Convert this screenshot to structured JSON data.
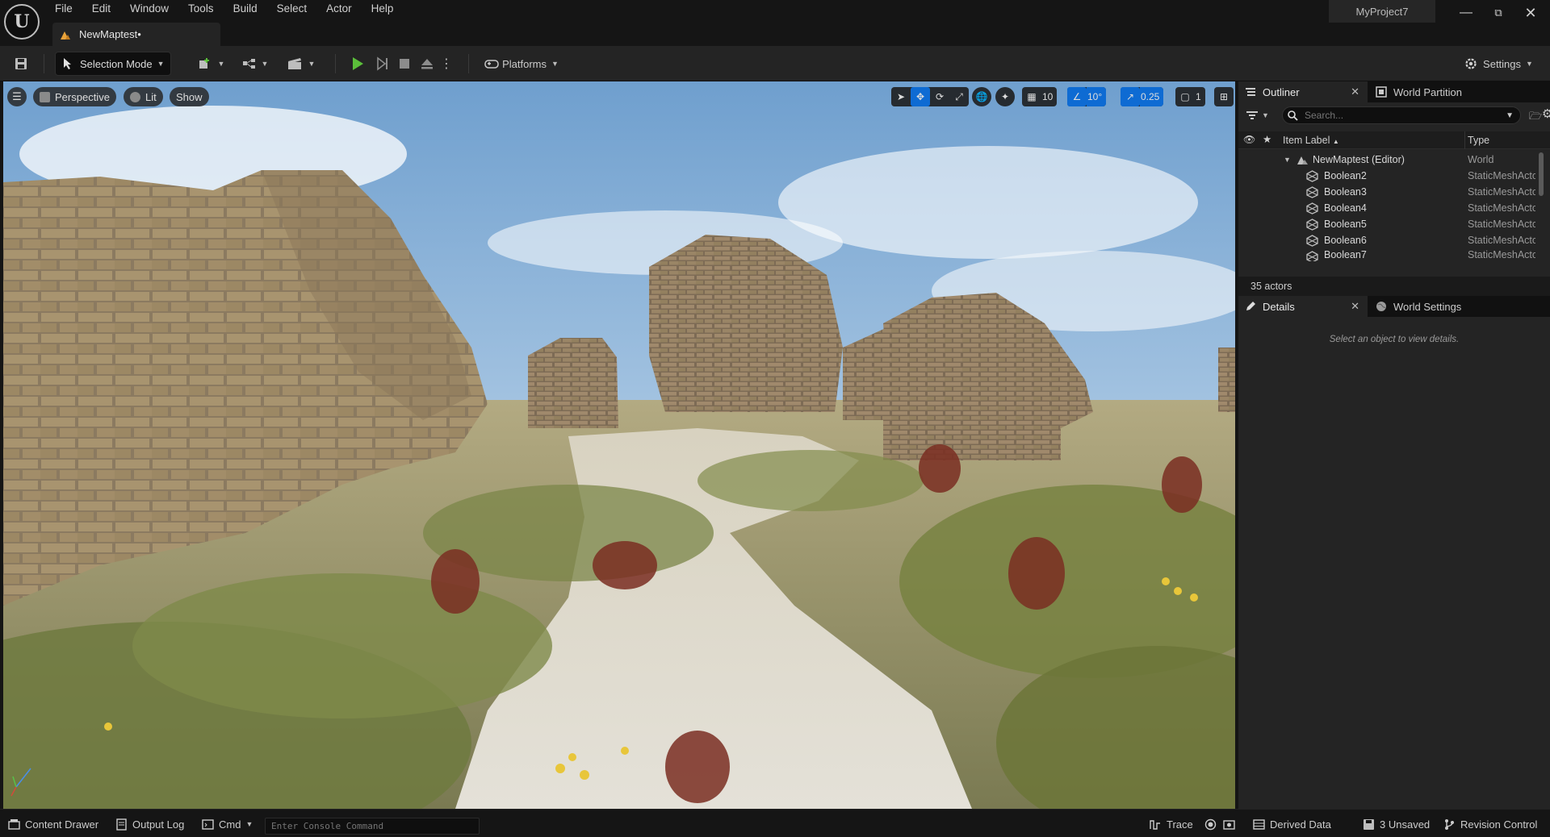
{
  "menu": [
    "File",
    "Edit",
    "Window",
    "Tools",
    "Build",
    "Select",
    "Actor",
    "Help"
  ],
  "project_name": "MyProject7",
  "document_tab": "NewMaptest•",
  "toolbar": {
    "selection_mode": "Selection Mode",
    "platforms": "Platforms",
    "settings": "Settings"
  },
  "viewport": {
    "perspective": "Perspective",
    "lit": "Lit",
    "show": "Show",
    "grid_snap": "10",
    "rotation_snap": "10°",
    "scale_snap": "0.25",
    "camera_speed": "1"
  },
  "outliner": {
    "tab_label": "Outliner",
    "world_partition_tab": "World Partition",
    "search_placeholder": "Search...",
    "col_label": "Item Label",
    "col_type": "Type",
    "world_row": {
      "label": "NewMaptest (Editor)",
      "type": "World"
    },
    "rows": [
      {
        "label": "Boolean2",
        "type": "StaticMeshActor"
      },
      {
        "label": "Boolean3",
        "type": "StaticMeshActor"
      },
      {
        "label": "Boolean4",
        "type": "StaticMeshActor"
      },
      {
        "label": "Boolean5",
        "type": "StaticMeshActor"
      },
      {
        "label": "Boolean6",
        "type": "StaticMeshActor"
      },
      {
        "label": "Boolean7",
        "type": "StaticMeshActor"
      }
    ],
    "actor_count": "35 actors"
  },
  "details": {
    "tab_label": "Details",
    "world_settings_tab": "World Settings",
    "empty_message": "Select an object to view details."
  },
  "statusbar": {
    "content_drawer": "Content Drawer",
    "output_log": "Output Log",
    "cmd": "Cmd",
    "console_placeholder": "Enter Console Command",
    "trace": "Trace",
    "derived_data": "Derived Data",
    "unsaved": "3 Unsaved",
    "revision_control": "Revision Control"
  },
  "colors": {
    "accent_blue": "#0e6bd3",
    "play_green": "#5bbf3a",
    "panel_bg": "#242424",
    "app_bg": "#151515"
  }
}
